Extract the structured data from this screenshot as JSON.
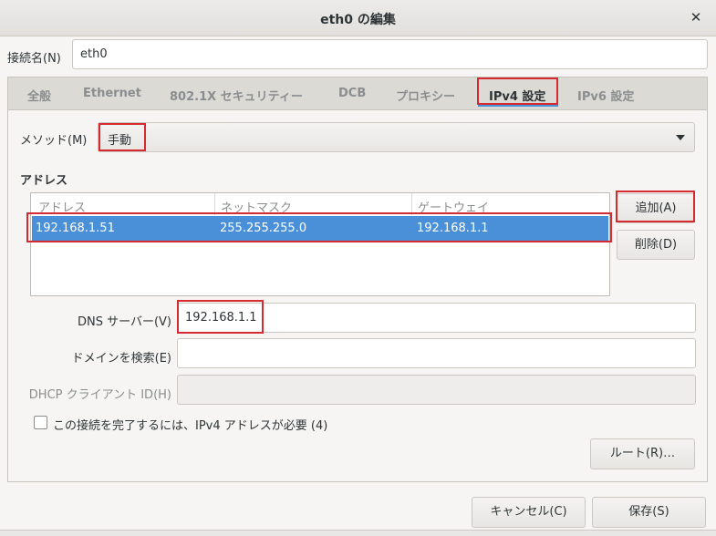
{
  "window": {
    "title": "eth0 の編集"
  },
  "connection": {
    "label": "接続名(N)",
    "value": "eth0"
  },
  "tabs": [
    "全般",
    "Ethernet",
    "802.1X セキュリティー",
    "DCB",
    "プロキシー",
    "IPv4 設定",
    "IPv6 設定"
  ],
  "method": {
    "label": "メソッド(M)",
    "value": "手動"
  },
  "address_section": {
    "heading": "アドレス",
    "columns": [
      "アドレス",
      "ネットマスク",
      "ゲートウェイ"
    ],
    "rows": [
      {
        "address": "192.168.1.51",
        "netmask": "255.255.255.0",
        "gateway": "192.168.1.1"
      }
    ],
    "add_label": "追加(A)",
    "delete_label": "削除(D)"
  },
  "dns": {
    "label": "DNS サーバー(V)",
    "value": "192.168.1.1"
  },
  "search_domain": {
    "label": "ドメインを検索(E)",
    "value": ""
  },
  "dhcp_client_id": {
    "label": "DHCP クライアント ID(H)",
    "value": ""
  },
  "require_ipv4": {
    "label": "この接続を完了するには、IPv4 アドレスが必要 (4)",
    "checked": false
  },
  "routes_label": "ルート(R)…",
  "footer": {
    "cancel_label": "キャンセル(C)",
    "save_label": "保存(S)"
  },
  "colors": {
    "highlight": "#d52b30",
    "selection": "#4a90d9"
  }
}
